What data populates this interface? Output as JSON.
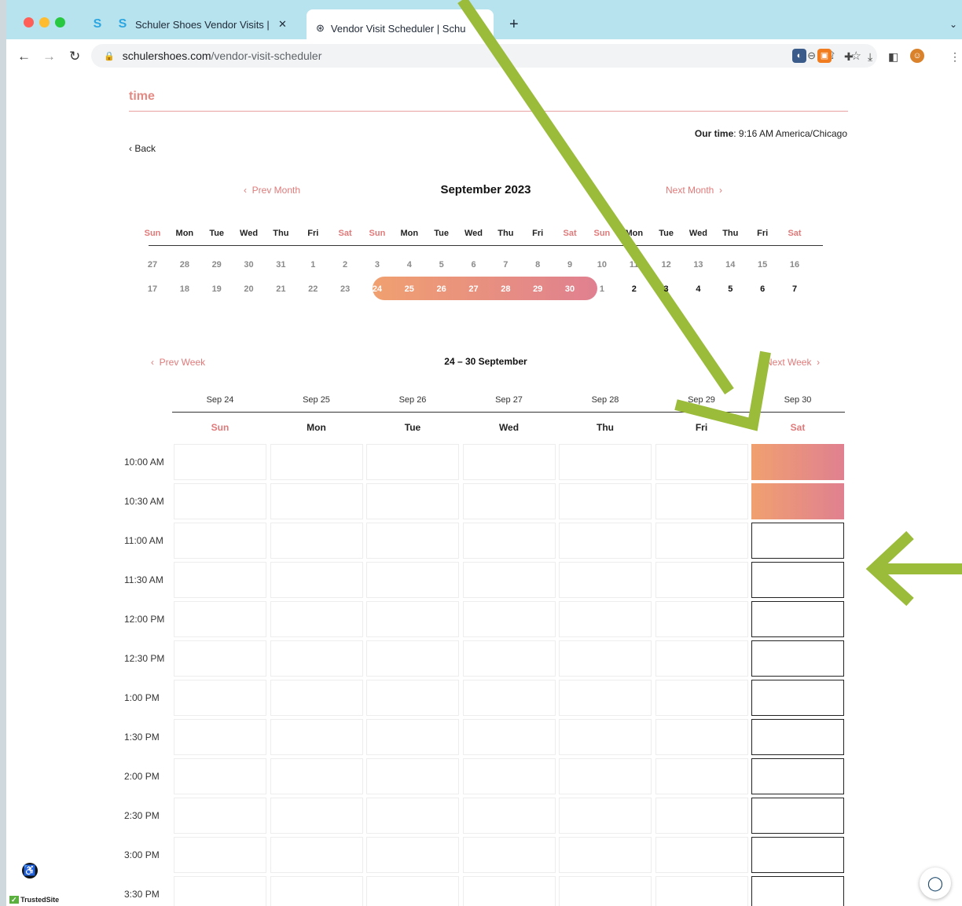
{
  "browser": {
    "tabs": [
      {
        "title": "Schuler Shoes Vendor Visits | S"
      },
      {
        "title": "Vendor Visit Scheduler | Schu"
      }
    ],
    "new_tab": "+",
    "url_domain": "schulershoes.com",
    "url_path": "/vendor-visit-scheduler"
  },
  "header": {
    "title": "time",
    "our_time_label": "Our time",
    "our_time_value": ": 9:16 AM America/Chicago",
    "back": "Back"
  },
  "month": {
    "prev": "Prev Month",
    "title": "September 2023",
    "next": "Next Month",
    "weekdays": [
      "Sun",
      "Mon",
      "Tue",
      "Wed",
      "Thu",
      "Fri",
      "Sat",
      "Sun",
      "Mon",
      "Tue",
      "Wed",
      "Thu",
      "Fri",
      "Sat",
      "Sun",
      "Mon",
      "Tue",
      "Wed",
      "Thu",
      "Fri",
      "Sat"
    ],
    "row1": [
      "27",
      "28",
      "29",
      "30",
      "31",
      "1",
      "2",
      "3",
      "4",
      "5",
      "6",
      "7",
      "8",
      "9",
      "10",
      "11",
      "12",
      "13",
      "14",
      "15",
      "16"
    ],
    "row2": [
      "17",
      "18",
      "19",
      "20",
      "21",
      "22",
      "23",
      "24",
      "25",
      "26",
      "27",
      "28",
      "29",
      "30",
      "1",
      "2",
      "3",
      "4",
      "5",
      "6",
      "7"
    ]
  },
  "week": {
    "prev": "Prev Week",
    "title": "24 – 30 September",
    "next": "Next Week",
    "dates": [
      "Sep 24",
      "Sep 25",
      "Sep 26",
      "Sep 27",
      "Sep 28",
      "Sep 29",
      "Sep 30"
    ],
    "days": [
      "Sun",
      "Mon",
      "Tue",
      "Wed",
      "Thu",
      "Fri",
      "Sat"
    ],
    "times": [
      "10:00 AM",
      "10:30 AM",
      "11:00 AM",
      "11:30 AM",
      "12:00 PM",
      "12:30 PM",
      "1:00 PM",
      "1:30 PM",
      "2:00 PM",
      "2:30 PM",
      "3:00 PM",
      "3:30 PM"
    ]
  },
  "footer": {
    "trusted": "TrustedSite"
  },
  "colors": {
    "accent": "#e07a7a",
    "gradient_start": "#f0a070",
    "gradient_end": "#e08090",
    "annotation_arrow": "#9bbb3b"
  }
}
